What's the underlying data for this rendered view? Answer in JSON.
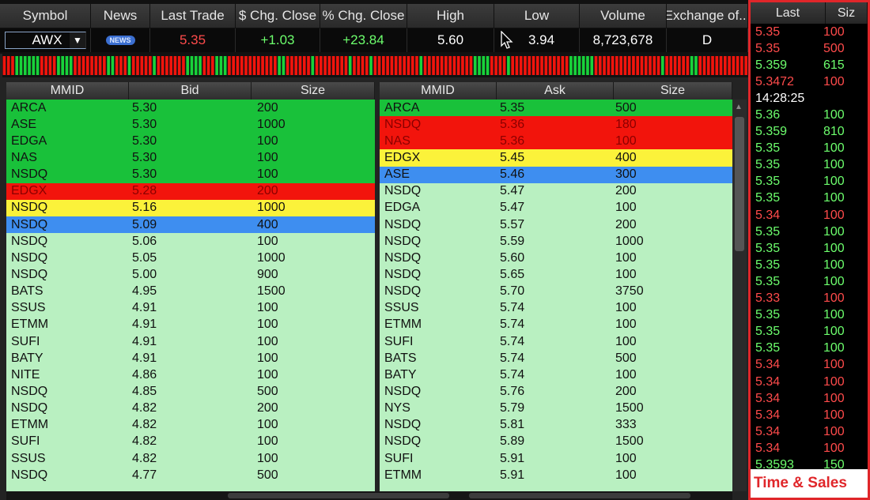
{
  "quote": {
    "headers": [
      "Symbol",
      "News",
      "Last Trade",
      "$ Chg. Close",
      "% Chg. Close",
      "High",
      "Low",
      "Volume",
      "Exchange of..."
    ],
    "symbol": "AWX",
    "news_badge": "NEWS",
    "last_trade": "5.35",
    "chg_close": "+1.03",
    "pct_chg_close": "+23.84",
    "high": "5.60",
    "low": "3.94",
    "volume": "8,723,678",
    "exchange": "D"
  },
  "tickbar": {
    "pattern": "RRRGGGGGGRRRRGGGGRRRRRRRRGGRRRGRRRRRGRRRRRRRGGGGRRRGGGRRRRRRRRRRRRGGRRRRRRGRRRRRRRRGRRRRGRRRRRRRRRRRGRRRRRRRRRRRRGGGGRRRRGRRRRRRRRRRRRRRGGGGGGRRRRRRRRRRRRRRRRGRRRRRRGGRRRRRRRRRRRR",
    "colors": {
      "R": "#f2140c",
      "G": "#18d33a"
    }
  },
  "bid": {
    "headers": [
      "MMID",
      "Bid",
      "Size"
    ],
    "rows": [
      {
        "mmid": "ARCA",
        "price": "5.30",
        "size": "200",
        "level": "green"
      },
      {
        "mmid": "ASE",
        "price": "5.30",
        "size": "1000",
        "level": "green"
      },
      {
        "mmid": "EDGA",
        "price": "5.30",
        "size": "100",
        "level": "green"
      },
      {
        "mmid": "NAS",
        "price": "5.30",
        "size": "100",
        "level": "green"
      },
      {
        "mmid": "NSDQ",
        "price": "5.30",
        "size": "100",
        "level": "green"
      },
      {
        "mmid": "EDGX",
        "price": "5.28",
        "size": "200",
        "level": "red"
      },
      {
        "mmid": "NSDQ",
        "price": "5.16",
        "size": "1000",
        "level": "yellow"
      },
      {
        "mmid": "NSDQ",
        "price": "5.09",
        "size": "400",
        "level": "blue"
      },
      {
        "mmid": "NSDQ",
        "price": "5.06",
        "size": "100",
        "level": "light"
      },
      {
        "mmid": "NSDQ",
        "price": "5.05",
        "size": "1000",
        "level": "light"
      },
      {
        "mmid": "NSDQ",
        "price": "5.00",
        "size": "900",
        "level": "light"
      },
      {
        "mmid": "BATS",
        "price": "4.95",
        "size": "1500",
        "level": "light"
      },
      {
        "mmid": "SSUS",
        "price": "4.91",
        "size": "100",
        "level": "light"
      },
      {
        "mmid": "ETMM",
        "price": "4.91",
        "size": "100",
        "level": "light"
      },
      {
        "mmid": "SUFI",
        "price": "4.91",
        "size": "100",
        "level": "light"
      },
      {
        "mmid": "BATY",
        "price": "4.91",
        "size": "100",
        "level": "light"
      },
      {
        "mmid": "NITE",
        "price": "4.86",
        "size": "100",
        "level": "light"
      },
      {
        "mmid": "NSDQ",
        "price": "4.85",
        "size": "500",
        "level": "light"
      },
      {
        "mmid": "NSDQ",
        "price": "4.82",
        "size": "200",
        "level": "light"
      },
      {
        "mmid": "ETMM",
        "price": "4.82",
        "size": "100",
        "level": "light"
      },
      {
        "mmid": "SUFI",
        "price": "4.82",
        "size": "100",
        "level": "light"
      },
      {
        "mmid": "SSUS",
        "price": "4.82",
        "size": "100",
        "level": "light"
      },
      {
        "mmid": "NSDQ",
        "price": "4.77",
        "size": "500",
        "level": "light"
      }
    ]
  },
  "ask": {
    "headers": [
      "MMID",
      "Ask",
      "Size"
    ],
    "rows": [
      {
        "mmid": "ARCA",
        "price": "5.35",
        "size": "500",
        "level": "green"
      },
      {
        "mmid": "NSDQ",
        "price": "5.36",
        "size": "180",
        "level": "red"
      },
      {
        "mmid": "NAS",
        "price": "5.36",
        "size": "100",
        "level": "red"
      },
      {
        "mmid": "EDGX",
        "price": "5.45",
        "size": "400",
        "level": "yellow"
      },
      {
        "mmid": "ASE",
        "price": "5.46",
        "size": "300",
        "level": "blue"
      },
      {
        "mmid": "NSDQ",
        "price": "5.47",
        "size": "200",
        "level": "light"
      },
      {
        "mmid": "EDGA",
        "price": "5.47",
        "size": "100",
        "level": "light"
      },
      {
        "mmid": "NSDQ",
        "price": "5.57",
        "size": "200",
        "level": "light"
      },
      {
        "mmid": "NSDQ",
        "price": "5.59",
        "size": "1000",
        "level": "light"
      },
      {
        "mmid": "NSDQ",
        "price": "5.60",
        "size": "100",
        "level": "light"
      },
      {
        "mmid": "NSDQ",
        "price": "5.65",
        "size": "100",
        "level": "light"
      },
      {
        "mmid": "NSDQ",
        "price": "5.70",
        "size": "3750",
        "level": "light"
      },
      {
        "mmid": "SSUS",
        "price": "5.74",
        "size": "100",
        "level": "light"
      },
      {
        "mmid": "ETMM",
        "price": "5.74",
        "size": "100",
        "level": "light"
      },
      {
        "mmid": "SUFI",
        "price": "5.74",
        "size": "100",
        "level": "light"
      },
      {
        "mmid": "BATS",
        "price": "5.74",
        "size": "500",
        "level": "light"
      },
      {
        "mmid": "BATY",
        "price": "5.74",
        "size": "100",
        "level": "light"
      },
      {
        "mmid": "NSDQ",
        "price": "5.76",
        "size": "200",
        "level": "light"
      },
      {
        "mmid": "NYS",
        "price": "5.79",
        "size": "1500",
        "level": "light"
      },
      {
        "mmid": "NSDQ",
        "price": "5.81",
        "size": "333",
        "level": "light"
      },
      {
        "mmid": "NSDQ",
        "price": "5.89",
        "size": "1500",
        "level": "light"
      },
      {
        "mmid": "SUFI",
        "price": "5.91",
        "size": "100",
        "level": "light"
      },
      {
        "mmid": "ETMM",
        "price": "5.91",
        "size": "100",
        "level": "light"
      }
    ]
  },
  "time_sales": {
    "headers": [
      "Last",
      "Siz"
    ],
    "label": "Time & Sales",
    "rows": [
      {
        "last": "5.35",
        "size": "100",
        "dir": "down"
      },
      {
        "last": "5.35",
        "size": "500",
        "dir": "down"
      },
      {
        "last": "5.359",
        "size": "615",
        "dir": "up"
      },
      {
        "last": "5.3472",
        "size": "100",
        "dir": "down"
      },
      {
        "time": "14:28:25"
      },
      {
        "last": "5.36",
        "size": "100",
        "dir": "up"
      },
      {
        "last": "5.359",
        "size": "810",
        "dir": "up"
      },
      {
        "last": "5.35",
        "size": "100",
        "dir": "up"
      },
      {
        "last": "5.35",
        "size": "100",
        "dir": "up"
      },
      {
        "last": "5.35",
        "size": "100",
        "dir": "up"
      },
      {
        "last": "5.35",
        "size": "100",
        "dir": "up"
      },
      {
        "last": "5.34",
        "size": "100",
        "dir": "down"
      },
      {
        "last": "5.35",
        "size": "100",
        "dir": "up"
      },
      {
        "last": "5.35",
        "size": "100",
        "dir": "up"
      },
      {
        "last": "5.35",
        "size": "100",
        "dir": "up"
      },
      {
        "last": "5.35",
        "size": "100",
        "dir": "up"
      },
      {
        "last": "5.33",
        "size": "100",
        "dir": "down"
      },
      {
        "last": "5.35",
        "size": "100",
        "dir": "up"
      },
      {
        "last": "5.35",
        "size": "100",
        "dir": "up"
      },
      {
        "last": "5.35",
        "size": "100",
        "dir": "up"
      },
      {
        "last": "5.34",
        "size": "100",
        "dir": "down"
      },
      {
        "last": "5.34",
        "size": "100",
        "dir": "down"
      },
      {
        "last": "5.34",
        "size": "100",
        "dir": "down"
      },
      {
        "last": "5.34",
        "size": "100",
        "dir": "down"
      },
      {
        "last": "5.34",
        "size": "100",
        "dir": "down"
      },
      {
        "last": "5.34",
        "size": "100",
        "dir": "down"
      },
      {
        "last": "5.3593",
        "size": "150",
        "dir": "up"
      }
    ]
  }
}
